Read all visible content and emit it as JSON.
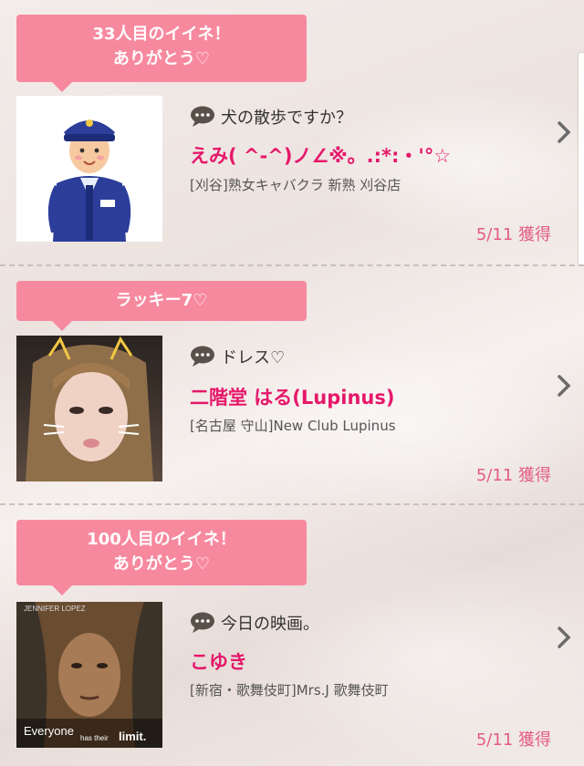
{
  "items": [
    {
      "bubble_line1": "33人目のイイネ！",
      "bubble_line2": "ありがとう♡",
      "comment": "犬の散歩ですか？",
      "name": "えみ( ^-^)ノ∠※。.:*:・'°☆",
      "shop": "[刈谷]熟女キャバクラ 新熟 刈谷店",
      "date": "5/11 獲得",
      "photo": "police-officer-illustration"
    },
    {
      "bubble_line1": "ラッキー7♡",
      "bubble_line2": "",
      "comment": "ドレス♡",
      "name": "二階堂 はる(Lupinus)",
      "shop": "[名古屋 守山]New Club Lupinus",
      "date": "5/11 獲得",
      "photo": "woman-selfie-photo"
    },
    {
      "bubble_line1": "100人目のイイネ！",
      "bubble_line2": "ありがとう♡",
      "comment": "今日の映画。",
      "name": "こゆき",
      "shop": "[新宿・歌舞伎町]Mrs.J 歌舞伎町",
      "date": "5/11 獲得",
      "photo": "movie-poster",
      "poster_top": "JENNIFER LOPEZ",
      "poster_bottom_1": "Everyone",
      "poster_bottom_2": "has their",
      "poster_bottom_3": "limit."
    }
  ],
  "colors": {
    "bubble": "#f7899f",
    "name": "#e6186a",
    "date": "#e35c82"
  }
}
